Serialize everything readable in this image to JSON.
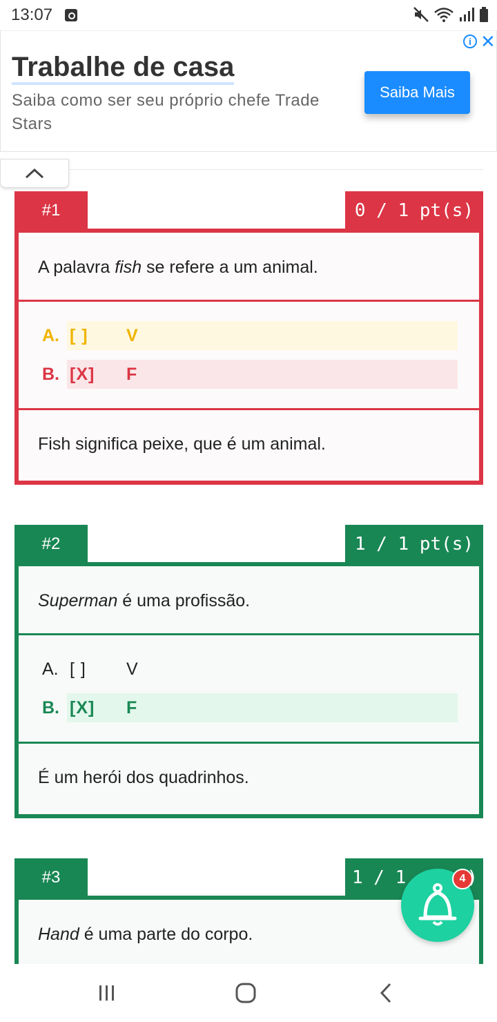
{
  "status_bar": {
    "time": "13:07",
    "icons": [
      "alarm-icon",
      "mute-icon",
      "wifi-icon",
      "signal-icon",
      "battery-icon"
    ]
  },
  "ad": {
    "title": "Trabalhe de casa",
    "subtitle": "Saiba como ser seu próprio chefe Trade Stars",
    "button_label": "Saiba Mais",
    "info_icon": "info-icon",
    "close_icon": "close-icon",
    "accent_color": "#1a8cff"
  },
  "collapse": {
    "icon": "chevron-up-icon"
  },
  "questions": [
    {
      "number": "#1",
      "points": "0 / 1 pt(s)",
      "status": "incorrect",
      "color": "#dc3545",
      "statement_pre": "A palavra ",
      "statement_em": "fish",
      "statement_post": " se refere a um animal.",
      "options": [
        {
          "letter": "A.",
          "mark": "[ ]",
          "value": "V"
        },
        {
          "letter": "B.",
          "mark": "[X]",
          "value": "F"
        }
      ],
      "explanation": "Fish significa peixe, que é um animal."
    },
    {
      "number": "#2",
      "points": "1 / 1 pt(s)",
      "status": "correct",
      "color": "#198754",
      "statement_em": "Superman",
      "statement_post": " é uma profissão.",
      "options": [
        {
          "letter": "A.",
          "mark": "[ ]",
          "value": "V"
        },
        {
          "letter": "B.",
          "mark": "[X]",
          "value": "F"
        }
      ],
      "explanation": "É um herói dos quadrinhos."
    },
    {
      "number": "#3",
      "points": "1 / 1",
      "points_tail": ")",
      "status": "correct",
      "color": "#198754",
      "statement_em": "Hand",
      "statement_post": " é uma parte do corpo."
    }
  ],
  "notification": {
    "icon": "bell-icon",
    "count": "4"
  },
  "nav": {
    "icons": [
      "recent-apps-icon",
      "home-icon",
      "back-icon"
    ]
  }
}
